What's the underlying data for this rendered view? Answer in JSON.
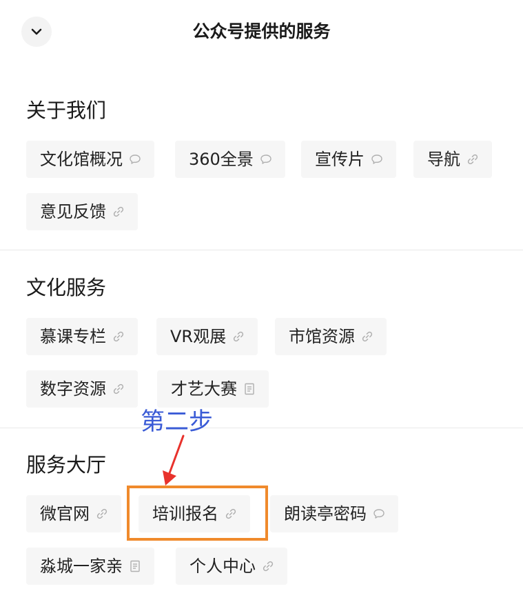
{
  "header": {
    "title": "公众号提供的服务",
    "back_icon": "chevron-down-icon"
  },
  "sections": [
    {
      "title": "关于我们",
      "items": [
        {
          "label": "文化馆概况",
          "icon": "chat-bubble-icon"
        },
        {
          "label": "360全景",
          "icon": "chat-bubble-icon"
        },
        {
          "label": "宣传片",
          "icon": "chat-bubble-icon"
        },
        {
          "label": "导航",
          "icon": "link-icon"
        },
        {
          "label": "意见反馈",
          "icon": "link-icon"
        }
      ]
    },
    {
      "title": "文化服务",
      "items": [
        {
          "label": "慕课专栏",
          "icon": "link-icon"
        },
        {
          "label": "VR观展",
          "icon": "link-icon"
        },
        {
          "label": "市馆资源",
          "icon": "link-icon"
        },
        {
          "label": "数字资源",
          "icon": "link-icon"
        },
        {
          "label": "才艺大赛",
          "icon": "document-icon"
        }
      ]
    },
    {
      "title": "服务大厅",
      "items": [
        {
          "label": "微官网",
          "icon": "link-icon"
        },
        {
          "label": "培训报名",
          "icon": "link-icon"
        },
        {
          "label": "朗读亭密码",
          "icon": "chat-bubble-icon"
        },
        {
          "label": "淼城一家亲",
          "icon": "document-icon"
        },
        {
          "label": "个人中心",
          "icon": "link-icon"
        }
      ]
    }
  ],
  "annotation": {
    "text": "第二步",
    "text_color": "#3a5bd6",
    "arrow_color": "#e8322c",
    "highlight_color": "#f08a2c"
  }
}
